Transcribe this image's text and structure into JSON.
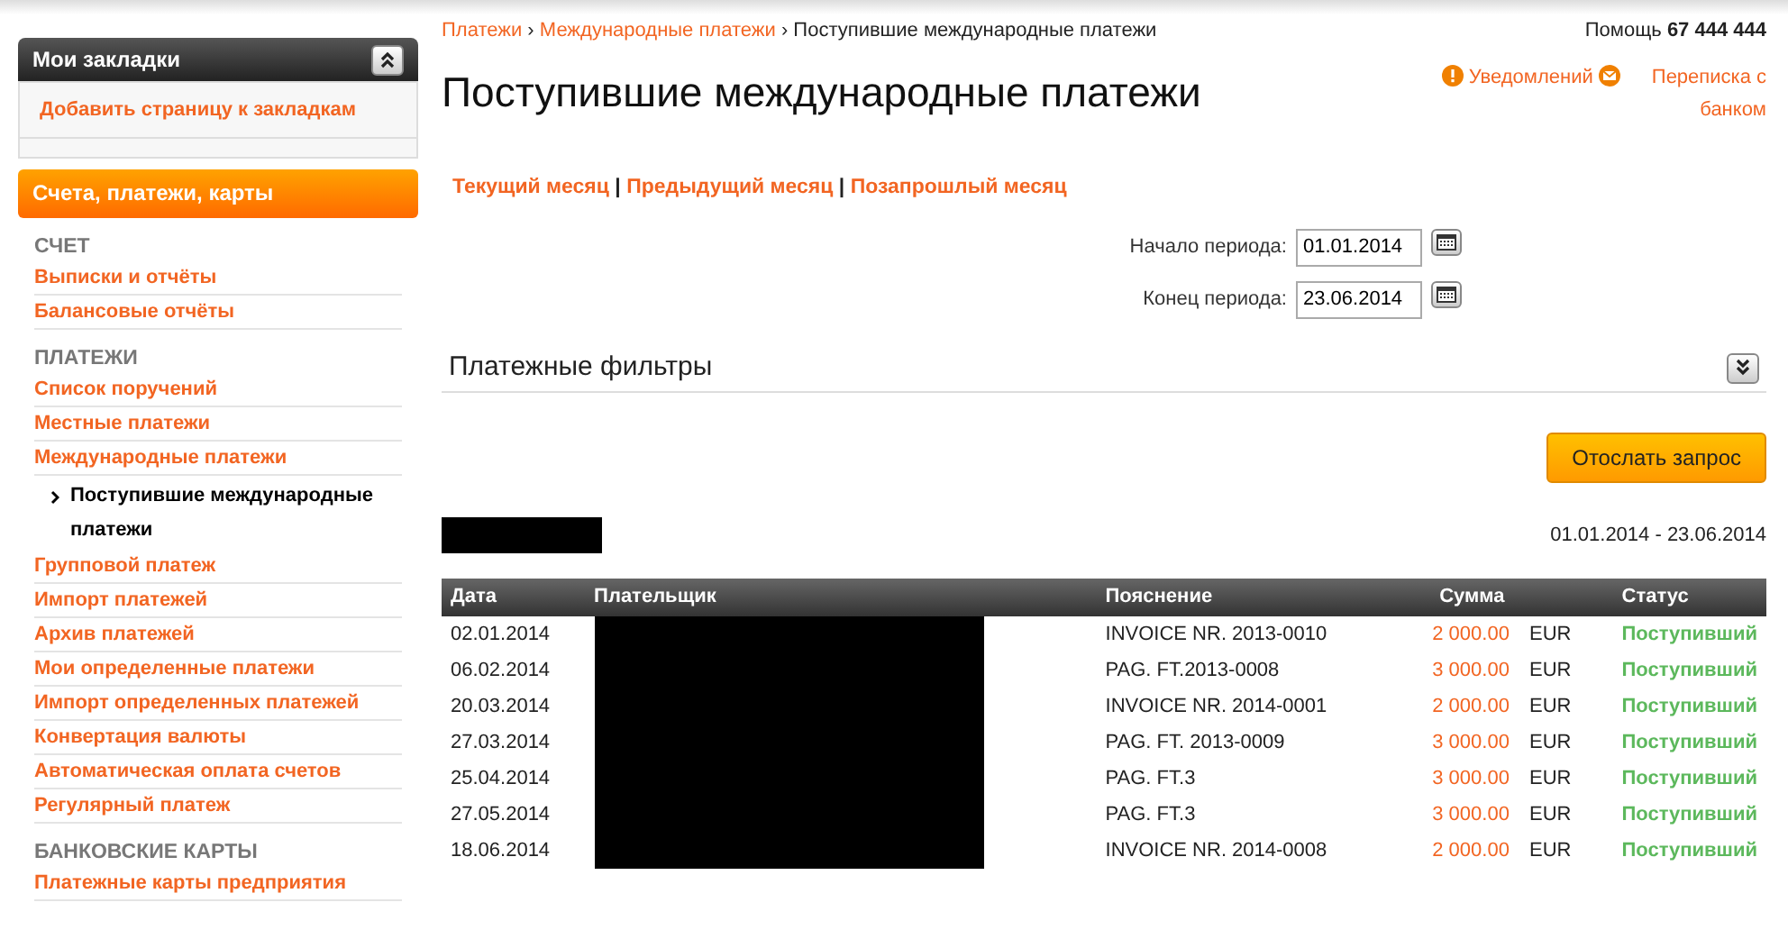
{
  "bookmarks": {
    "title": "Мои закладки",
    "expanded": true,
    "add_link": "Добавить страницу к закладкам"
  },
  "menu_header": "Счета, платежи, карты",
  "sidebar": [
    {
      "kind": "section",
      "label": "СЧЕТ"
    },
    {
      "kind": "link",
      "label": "Выписки и отчёты",
      "selected": false
    },
    {
      "kind": "link",
      "label": "Балансовые отчёты",
      "selected": false
    },
    {
      "kind": "section",
      "label": "ПЛАТЕЖИ"
    },
    {
      "kind": "link",
      "label": "Список поручений",
      "selected": false
    },
    {
      "kind": "link",
      "label": "Местные платежи",
      "selected": false
    },
    {
      "kind": "link",
      "label": "Международные платежи",
      "selected": false,
      "children": [
        {
          "label": "Поступившие международные платежи",
          "selected": true
        }
      ]
    },
    {
      "kind": "link",
      "label": "Групповой платеж",
      "selected": false
    },
    {
      "kind": "link",
      "label": "Импорт платежей",
      "selected": false
    },
    {
      "kind": "link",
      "label": "Архив платежей",
      "selected": false
    },
    {
      "kind": "link",
      "label": "Мои определенные платежи",
      "selected": false
    },
    {
      "kind": "link",
      "label": "Импорт определенных платежей",
      "selected": false
    },
    {
      "kind": "link",
      "label": "Конвертация валюты",
      "selected": false
    },
    {
      "kind": "link",
      "label": "Автоматическая оплата счетов",
      "selected": false
    },
    {
      "kind": "link",
      "label": "Регулярный платеж",
      "selected": false
    },
    {
      "kind": "section",
      "label": "БАНКОВСКИЕ КАРТЫ"
    },
    {
      "kind": "link",
      "label": "Платежные карты предприятия",
      "selected": false
    }
  ],
  "breadcrumbs": [
    "Платежи",
    "Международные платежи",
    "Поступившие международные платежи"
  ],
  "breadcrumb_separator": "›",
  "period_separator": "|",
  "help": {
    "label": "Помощь",
    "phone": "67 444 444"
  },
  "notifications": "Уведомлений",
  "messages": "Переписка с банком",
  "page_title": "Поступившие международные платежи",
  "periods": [
    "Текущий месяц",
    "Предыдущий месяц",
    "Позапрошлый месяц"
  ],
  "start": {
    "label": "Начало периода:",
    "value": "01.01.2014"
  },
  "end": {
    "label": "Конец периода:",
    "value": "23.06.2014"
  },
  "filters": {
    "title": "Платежные фильтры",
    "expanded": false
  },
  "submit": "Отослать запрос",
  "range": "01.01.2014 - 23.06.2014",
  "table": {
    "columns": [
      "Дата",
      "Плательщик",
      "Пояснение",
      "Сумма",
      "Статус"
    ],
    "rows": [
      {
        "date": "02.01.2014",
        "note": "INVOICE NR. 2013-0010",
        "amount": "2 000.00",
        "currency": "EUR",
        "status": "Поступивший"
      },
      {
        "date": "06.02.2014",
        "note": "PAG. FT.2013-0008",
        "amount": "3 000.00",
        "currency": "EUR",
        "status": "Поступивший"
      },
      {
        "date": "20.03.2014",
        "note": "INVOICE NR. 2014-0001",
        "amount": "2 000.00",
        "currency": "EUR",
        "status": "Поступивший"
      },
      {
        "date": "27.03.2014",
        "note": "PAG. FT. 2013-0009",
        "amount": "3 000.00",
        "currency": "EUR",
        "status": "Поступивший"
      },
      {
        "date": "25.04.2014",
        "note": "PAG. FT.3",
        "amount": "3 000.00",
        "currency": "EUR",
        "status": "Поступивший"
      },
      {
        "date": "27.05.2014",
        "note": "PAG. FT.3",
        "amount": "3 000.00",
        "currency": "EUR",
        "status": "Поступивший"
      },
      {
        "date": "18.06.2014",
        "note": "INVOICE NR. 2014-0008",
        "amount": "2 000.00",
        "currency": "EUR",
        "status": "Поступивший"
      }
    ]
  }
}
